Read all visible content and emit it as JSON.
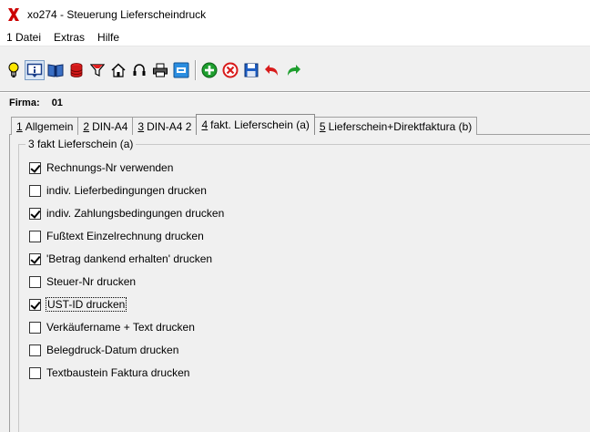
{
  "window": {
    "title": "xo274 - Steuerung Lieferscheindruck",
    "icon": "red-x-icon",
    "accent": "#cc0000"
  },
  "menu": [
    {
      "label": "1 Datei"
    },
    {
      "label": "Extras"
    },
    {
      "label": "Hilfe"
    }
  ],
  "toolbar": {
    "buttons": [
      {
        "icon": "lightbulb-icon"
      },
      {
        "icon": "info-icon"
      },
      {
        "icon": "book-icon"
      },
      {
        "icon": "database-icon"
      },
      {
        "icon": "filter-icon"
      },
      {
        "icon": "home-icon"
      },
      {
        "icon": "headset-icon"
      },
      {
        "icon": "printer-icon"
      },
      {
        "icon": "window-icon"
      },
      {
        "icon": "add-icon"
      },
      {
        "icon": "delete-icon"
      },
      {
        "icon": "save-icon"
      },
      {
        "icon": "undo-icon"
      },
      {
        "icon": "redo-icon"
      }
    ]
  },
  "firma": {
    "label": "Firma:",
    "value": "01"
  },
  "tabs": [
    {
      "num": "1",
      "label": "Allgemein"
    },
    {
      "num": "2",
      "label": "DIN-A4"
    },
    {
      "num": "3",
      "label": "DIN-A4 2"
    },
    {
      "num": "4",
      "label": "fakt. Lieferschein (a)",
      "active": true
    },
    {
      "num": "5",
      "label": "Lieferschein+Direktfaktura (b)"
    }
  ],
  "group": {
    "title": "3 fakt Lieferschein (a)",
    "options": [
      {
        "label": "Rechnungs-Nr verwenden",
        "checked": true
      },
      {
        "label": "indiv. Lieferbedingungen drucken",
        "checked": false
      },
      {
        "label": "indiv. Zahlungsbedingungen drucken",
        "checked": true
      },
      {
        "label": "Fußtext Einzelrechnung drucken",
        "checked": false
      },
      {
        "label": "'Betrag dankend erhalten' drucken",
        "checked": true
      },
      {
        "label": "Steuer-Nr drucken",
        "checked": false
      },
      {
        "label": "UST-ID drucken",
        "checked": true,
        "focused": true
      },
      {
        "label": "Verkäufername + Text drucken",
        "checked": false
      },
      {
        "label": "Belegdruck-Datum drucken",
        "checked": false
      },
      {
        "label": "Textbaustein Faktura drucken",
        "checked": false
      }
    ]
  }
}
